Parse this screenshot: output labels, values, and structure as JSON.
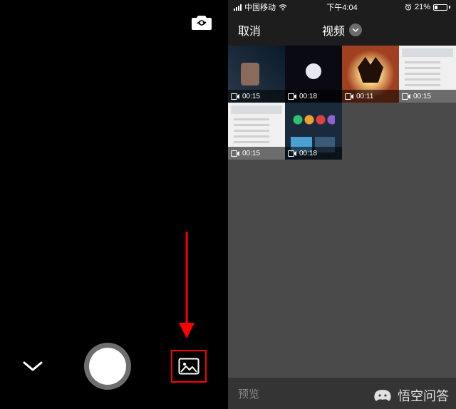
{
  "left": {
    "icons": {
      "camera_switch": "camera-switch-icon",
      "chevron": "chevron-down-icon",
      "gallery": "image-gallery-icon"
    }
  },
  "right": {
    "status": {
      "carrier": "中国移动",
      "time": "下午4:04",
      "battery_pct": "21%"
    },
    "header": {
      "cancel": "取消",
      "title": "视频"
    },
    "thumbs": [
      {
        "duration": "00:15"
      },
      {
        "duration": "00:18"
      },
      {
        "duration": "00:11"
      },
      {
        "duration": "00:15"
      },
      {
        "duration": "00:15"
      },
      {
        "duration": "00:18"
      }
    ],
    "footer": {
      "preview": "预览"
    }
  },
  "watermark": {
    "text": "悟空问答"
  }
}
